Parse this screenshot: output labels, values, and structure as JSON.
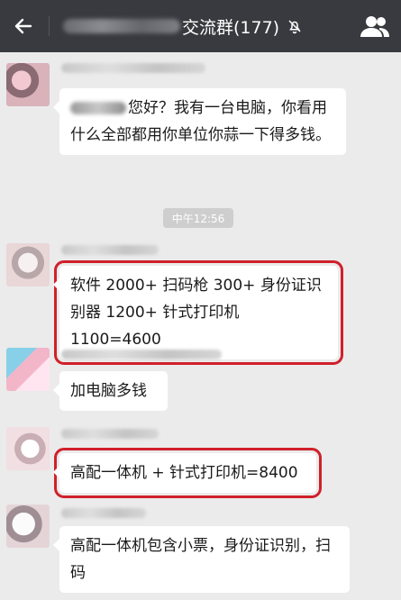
{
  "header": {
    "title": "交流群(177)",
    "icons": {
      "back": "arrow-left-icon",
      "mute": "bell-off-icon",
      "members": "group-members-icon"
    }
  },
  "chat": {
    "timestamp": "中午12:56",
    "messages": [
      {
        "text": "您好？我有一台电脑，你看用什么全部都用你单位你蒜一下得多钱。"
      },
      {
        "text": "软件 2000+ 扫码枪 300+ 身份证识别器 1200+ 针式打印机 1100=4600",
        "highlighted": true
      },
      {
        "text": "加电脑多钱"
      },
      {
        "text": "高配一体机 + 针式打印机=8400",
        "highlighted": true
      },
      {
        "text": "高配一体机包含小票，身份证识别，扫码"
      }
    ]
  },
  "colors": {
    "topbar": "#393a3f",
    "background": "#ebebeb",
    "highlight_outline": "#d0202a"
  }
}
